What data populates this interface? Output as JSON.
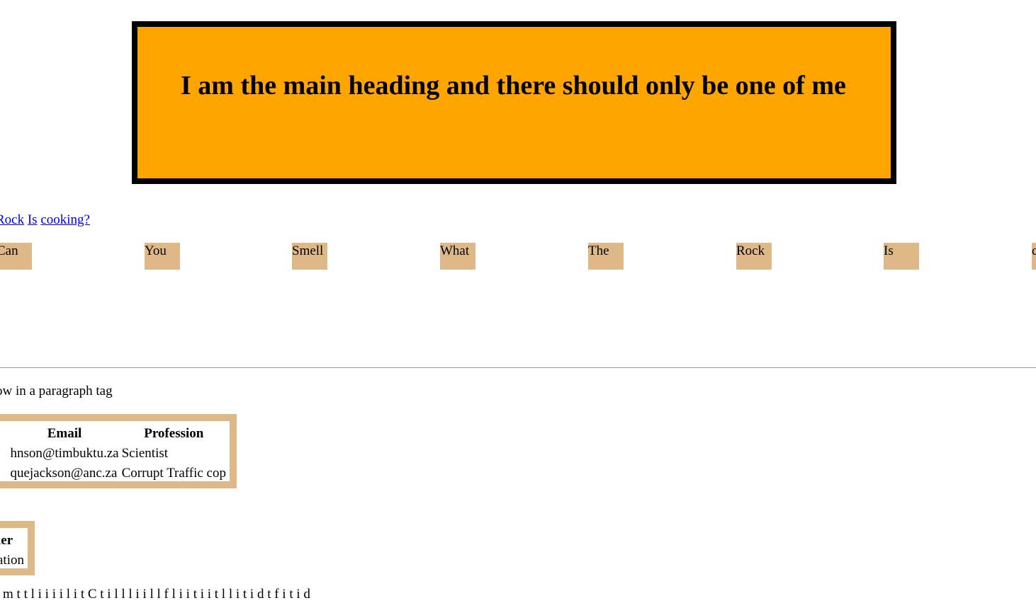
{
  "heading": "I am the main heading and there should only be one of me",
  "links": [
    {
      "label": "Rock"
    },
    {
      "label": "Is"
    },
    {
      "label": "cooking?"
    }
  ],
  "chips": [
    "Can",
    "You",
    "Smell",
    "What",
    "The",
    "Rock",
    "Is",
    "c"
  ],
  "paragraph": "ow in a paragraph tag",
  "table": {
    "headers": [
      "Email",
      "Profession"
    ],
    "rows": [
      [
        "hnson@timbuktu.za",
        "Scientist"
      ],
      [
        "quejackson@anc.za",
        "Corrupt Traffic cop"
      ]
    ]
  },
  "small_table": {
    "header": "ler",
    "cell": "ation"
  },
  "bottom_text": "t  m  t  t  l  i  i  i  i  l  i  t  C  t  i  l  l  l  i  i  l  l  f  l  i  i  t  i  i  t  l  l  i  t  i  d  t  f  i  t  i  d"
}
